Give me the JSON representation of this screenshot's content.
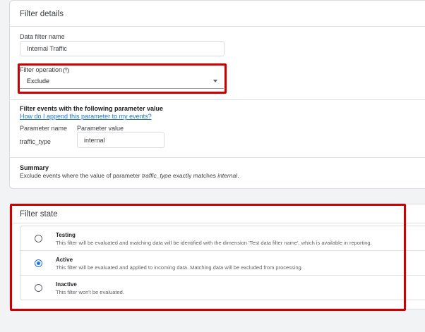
{
  "details": {
    "title": "Filter details",
    "name_label": "Data filter name",
    "name_value": "Internal Traffic",
    "operation_label": "Filter operation",
    "operation_help_glyph": "?",
    "operation_value": "Exclude",
    "param_section_title": "Filter events with the following parameter value",
    "param_help_link": "How do I append this parameter to my events?",
    "param_name_label": "Parameter name",
    "param_value_label": "Parameter value",
    "param_name": "traffic_type",
    "param_value": "internal",
    "summary_title": "Summary",
    "summary_prefix": "Exclude events where the value of parameter ",
    "summary_param": "traffic_type",
    "summary_middle": " exactly matches ",
    "summary_value": "internal",
    "summary_suffix": "."
  },
  "state": {
    "title": "Filter state",
    "options": [
      {
        "title": "Testing",
        "description": "This filter will be evaluated and matching data will be identified with the dimension 'Test data filter name', which is available in reporting.",
        "selected": false
      },
      {
        "title": "Active",
        "description": "This filter will be evaluated and applied to incoming data. Matching data will be excluded from processing.",
        "selected": true
      },
      {
        "title": "Inactive",
        "description": "This filter won't be evaluated.",
        "selected": false
      }
    ]
  },
  "colors": {
    "accent": "#1a73e8",
    "highlight": "#cc0000",
    "background": "#f1f3f4"
  }
}
